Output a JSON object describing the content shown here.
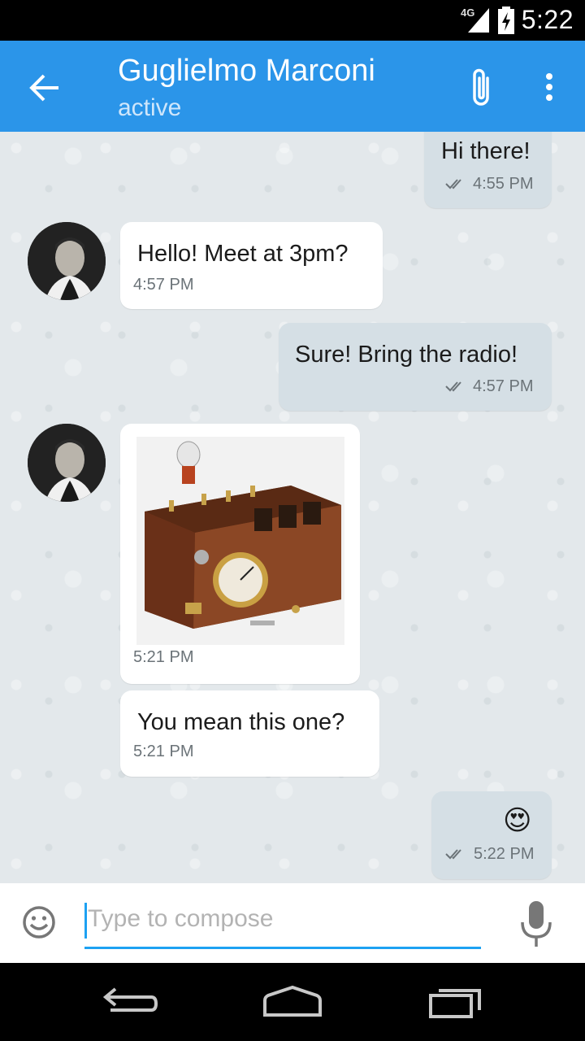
{
  "status_bar": {
    "network": "4G",
    "time": "5:22",
    "signal_icon": "signal-icon",
    "battery_icon": "battery-charging-icon"
  },
  "app_bar": {
    "contact_name": "Guglielmo Marconi",
    "contact_status": "active",
    "back_icon": "arrow-back-icon",
    "attach_icon": "paperclip-icon",
    "menu_icon": "more-vert-icon"
  },
  "messages": [
    {
      "direction": "outgoing",
      "text": "Hi there!",
      "time": "4:55 PM",
      "status_icon": "double-check-icon"
    },
    {
      "direction": "incoming",
      "text": "Hello! Meet at 3pm?",
      "time": "4:57 PM"
    },
    {
      "direction": "outgoing",
      "text": "Sure! Bring the radio!",
      "time": "4:57 PM",
      "status_icon": "double-check-icon"
    },
    {
      "direction": "incoming",
      "type": "image",
      "image_icon": "antique-radio-photo",
      "time": "5:21 PM"
    },
    {
      "direction": "incoming",
      "text": "You mean this one?",
      "time": "5:21 PM"
    },
    {
      "direction": "outgoing",
      "emoji": "😍",
      "time": "5:22 PM",
      "status_icon": "double-check-icon"
    }
  ],
  "composer": {
    "placeholder": "Type to compose",
    "emoji_icon": "emoji-icon",
    "mic_icon": "microphone-icon"
  },
  "nav_bar": {
    "back_icon": "nav-back-icon",
    "home_icon": "nav-home-icon",
    "recents_icon": "nav-recents-icon"
  },
  "colors": {
    "app_bar": "#2b95e9",
    "incoming_bubble": "#ffffff",
    "outgoing_bubble": "#d5dfe5",
    "chat_background": "#e3e8eb",
    "accent": "#1da1f2"
  }
}
